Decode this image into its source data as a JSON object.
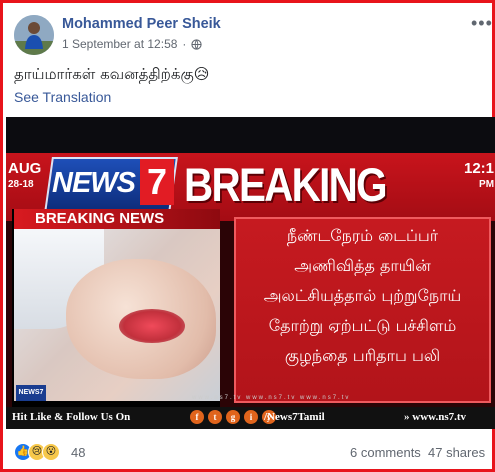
{
  "post": {
    "author": "Mohammed Peer Sheik",
    "date": "1 September at 12:58",
    "dot": "·",
    "text": "தாய்மார்கள் கவனத்திற்க்கு😥",
    "see_translation": "See Translation",
    "more": "•••"
  },
  "image": {
    "date_line1": "AUG",
    "date_line2": "28-18",
    "logo_text": "NEWS",
    "logo_number": "7",
    "headline": "BREAKING NEWS",
    "time_line1": "12:1",
    "time_line2": "PM",
    "inner_tag_part1": "BREAKING",
    "inner_tag_part2": "NEWS",
    "small_logo": "NEWS7",
    "tamil_lines": [
      "நீண்டநேரம் டைப்பர்",
      "அணிவித்த தாயின்",
      "அலட்சியத்தால் புற்றுநோய்",
      "தோற்று ஏற்பட்டு பச்சிளம்",
      "குழந்தை பரிதாப பலி"
    ],
    "ticker_left": "Hit Like & Follow Us On",
    "ticker_handle": "/News7Tamil",
    "ticker_site": "www.ns7.tv",
    "social_icons": [
      "f",
      "t",
      "g",
      "i",
      "y"
    ],
    "urls": "www.ns7.tv   www.ns7.tv   www.ns7.tv"
  },
  "footer": {
    "reaction_count": "48",
    "comments": "6 comments",
    "shares": "47 shares",
    "reaction_icons": [
      "like-icon",
      "sad-icon",
      "wow-icon"
    ]
  },
  "colors": {
    "border": "#e8141b",
    "link": "#385898",
    "banner_red": "#c8141c"
  }
}
